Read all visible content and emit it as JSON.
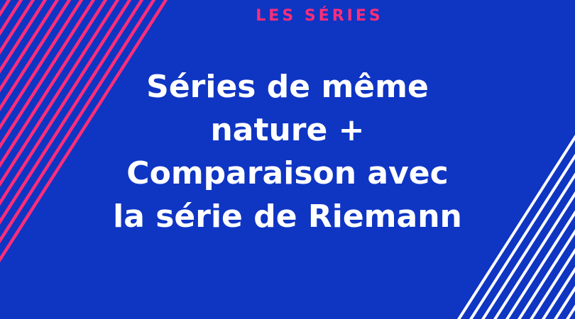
{
  "banner": {
    "kicker": "LES SÉRIES",
    "title_lines": [
      "Séries de même",
      "nature +",
      "Comparaison avec",
      "la série de Riemann"
    ]
  },
  "colors": {
    "background": "#0f35c3",
    "accent": "#ff2d78",
    "text": "#ffffff"
  },
  "decorations": {
    "left_stripes": "pink diagonal stripes",
    "right_stripes": "white diagonal stripes"
  }
}
